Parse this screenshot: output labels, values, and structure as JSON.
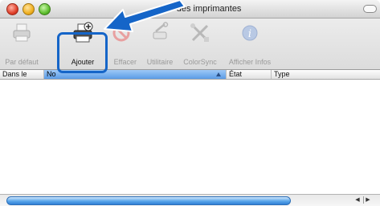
{
  "window": {
    "title": "iste des imprimantes"
  },
  "toolbar": {
    "buttons": [
      {
        "label": "Par défaut",
        "enabled": false,
        "icon": "printer-default-icon"
      },
      {
        "label": "Ajouter",
        "enabled": true,
        "icon": "printer-add-icon"
      },
      {
        "label": "Effacer",
        "enabled": false,
        "icon": "delete-icon"
      },
      {
        "label": "Utilitaire",
        "enabled": false,
        "icon": "utility-tools-icon"
      },
      {
        "label": "ColorSync",
        "enabled": false,
        "icon": "colorsync-icon"
      },
      {
        "label": "Afficher Infos",
        "enabled": false,
        "icon": "info-icon"
      }
    ]
  },
  "columns": {
    "in_menu": "Dans le",
    "name": "No",
    "state": "État",
    "type": "Type"
  },
  "colors": {
    "highlight": "#1565c8",
    "arrow": "#1565c8",
    "selection": "#5a9be6"
  }
}
